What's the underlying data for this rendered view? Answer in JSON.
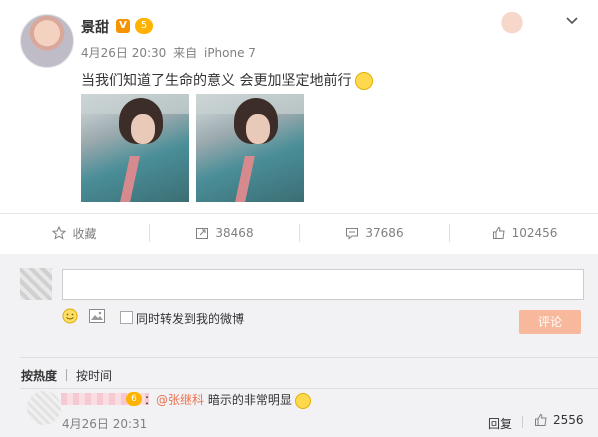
{
  "post": {
    "username": "景甜",
    "verified_badge": "V",
    "level_badge": "5",
    "timestamp": "4月26日 20:30",
    "source_prefix": "来自",
    "source": "iPhone 7",
    "text": "当我们知道了生命的意义 会更加坚定地前行",
    "images": [
      "photo-1",
      "photo-2"
    ]
  },
  "actions": {
    "favorite_label": "收藏",
    "repost_count": "38468",
    "comment_count": "37686",
    "like_count": "102456"
  },
  "composer": {
    "placeholder": "",
    "forward_label": "同时转发到我的微博",
    "submit_label": "评论"
  },
  "sort": {
    "hot_label": "按热度",
    "time_label": "按时间"
  },
  "comment": {
    "level_badge": "6",
    "prefix": "：",
    "mention": "@张继科",
    "text": " 暗示的非常明显",
    "date": "4月26日 20:31",
    "reply_label": "回复",
    "like_count": "2556"
  },
  "colors": {
    "accent": "#eb7350",
    "submit_disabled": "#f7b89b",
    "panel": "#f2f2f5"
  }
}
